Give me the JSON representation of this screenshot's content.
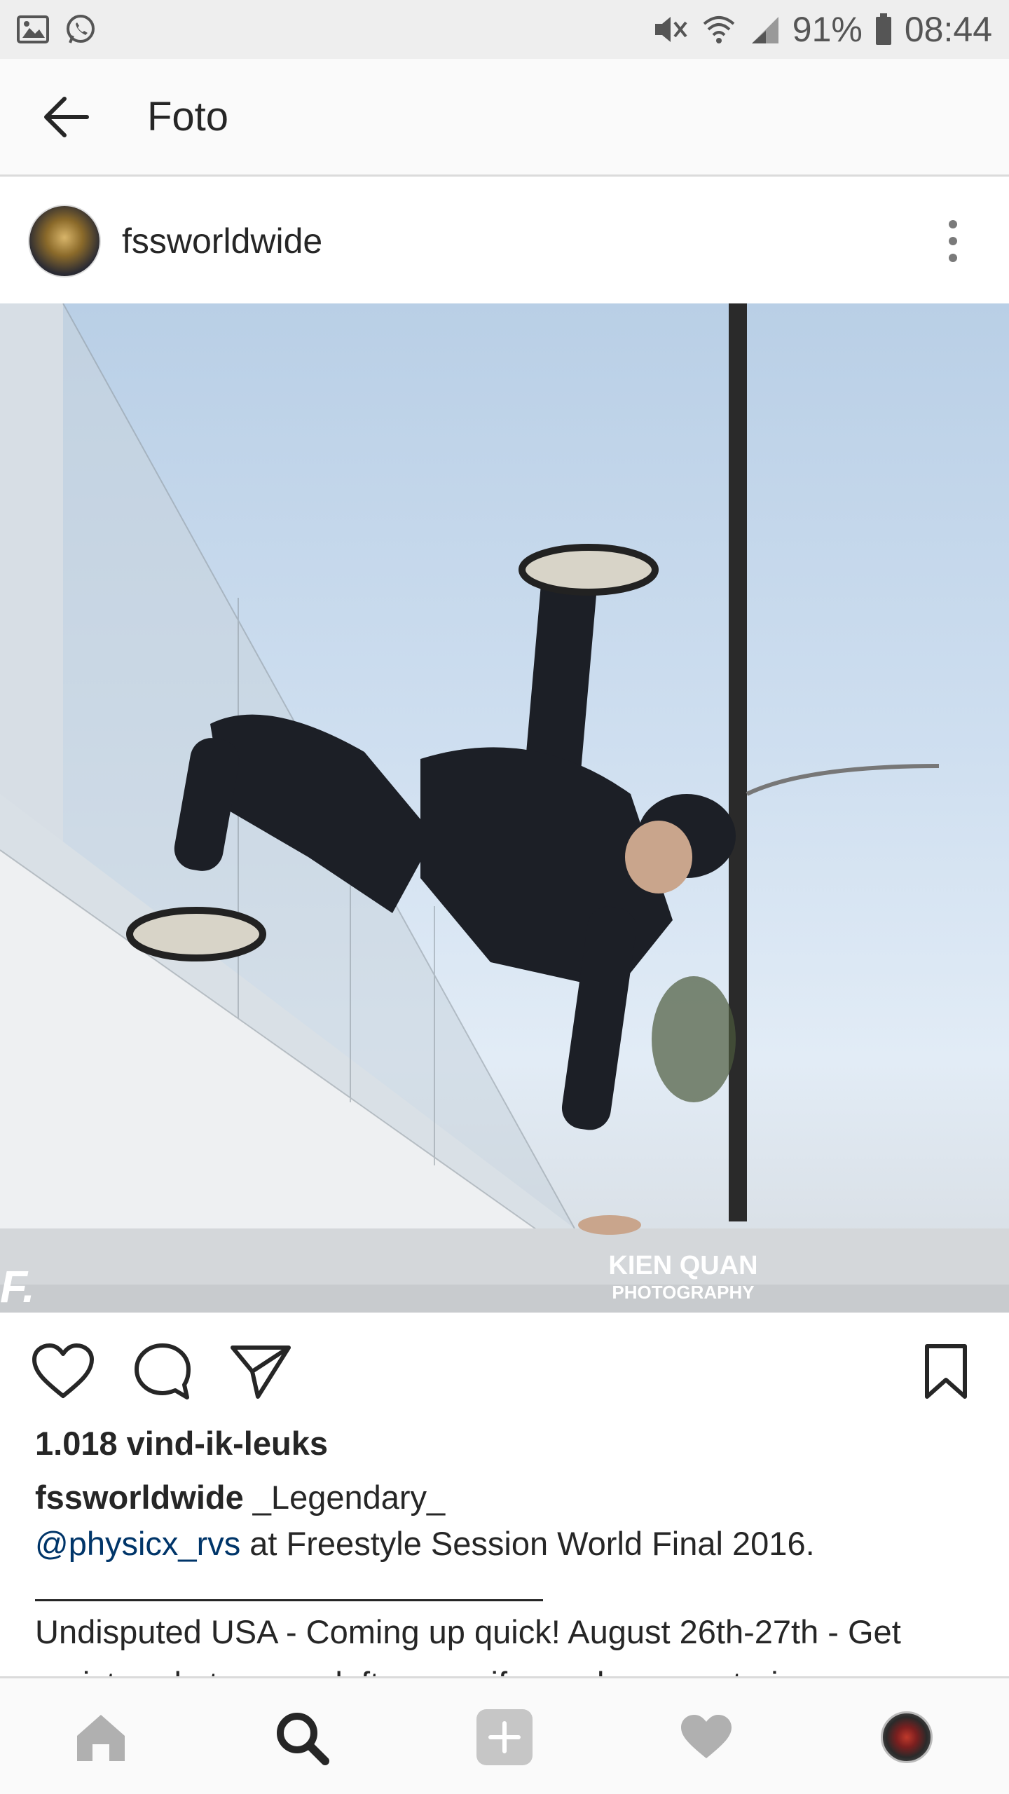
{
  "status_bar": {
    "battery_percent": "91%",
    "time": "08:44",
    "icons": [
      "image-icon",
      "whatsapp-icon",
      "mute-icon",
      "wifi-icon",
      "signal-icon",
      "battery-icon"
    ]
  },
  "app_bar": {
    "title": "Foto",
    "back_icon": "arrow-left-icon"
  },
  "post": {
    "username": "fssworldwide",
    "more_icon": "more-vertical-icon",
    "photo_watermark_line1": "KIEN QUAN",
    "photo_watermark_line2": "PHOTOGRAPHY",
    "photo_corner_mark": "F.",
    "actions": {
      "like_icon": "heart-outline-icon",
      "comment_icon": "comment-icon",
      "share_icon": "send-icon",
      "save_icon": "bookmark-icon"
    },
    "likes": "1.018 vind-ik-leuks",
    "caption_user": "fssworldwide",
    "caption_text": "_Legendary_",
    "caption_mention": "@physicx_rvs",
    "caption_line2_rest": "at Freestyle Session World Final 2016.",
    "caption_more": "Undisputed USA - Coming up quick! August 26th-27th - Get registered at www.udeftour.org if you plan on entering."
  },
  "bottom_nav": {
    "items": [
      "home-icon",
      "search-icon",
      "add-icon",
      "heart-icon",
      "profile-avatar"
    ],
    "active": "search-icon"
  },
  "colors": {
    "mention": "#003569",
    "text": "#262626",
    "nav_inactive": "#b0b0b0",
    "nav_active": "#262626"
  }
}
